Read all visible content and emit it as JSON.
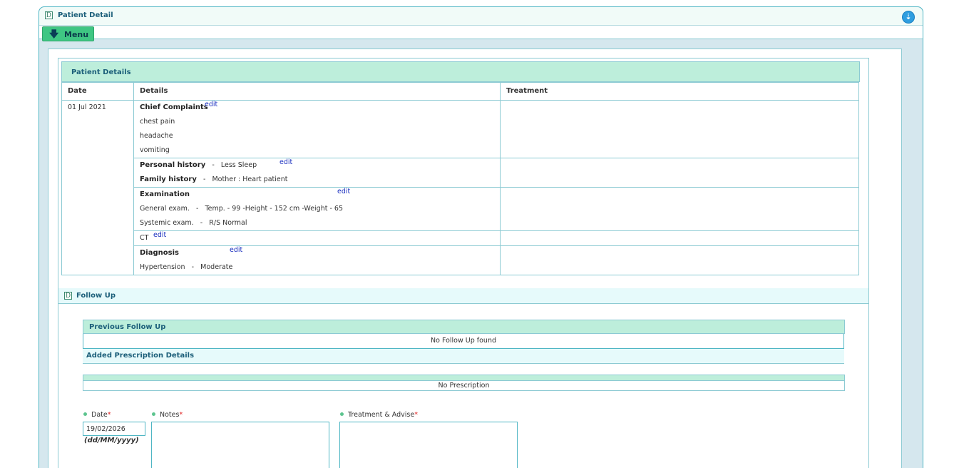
{
  "window": {
    "title": "Patient Detail",
    "icon": "d-icon",
    "action_icon": "download-circle-icon"
  },
  "menu": {
    "label": "Menu",
    "icon": "arrow-down-icon"
  },
  "patient_details": {
    "title": "Patient Details",
    "columns": [
      "Date",
      "Details",
      "Treatment"
    ],
    "date": "01 Jul 2021",
    "chief_complaints": {
      "label": "Chief Complaints",
      "edit": "edit",
      "items": [
        "chest pain",
        "headache",
        "vomiting"
      ]
    },
    "personal_history": {
      "label": "Personal history",
      "value": "Less Sleep",
      "edit": "edit"
    },
    "family_history": {
      "label": "Family history",
      "value": "Mother : Heart patient"
    },
    "examination": {
      "label": "Examination",
      "edit": "edit",
      "general_label": "General exam.",
      "general_value": "Temp. - 99 -Height - 152 cm -Weight - 65",
      "systemic_label": "Systemic exam.",
      "systemic_value": "R/S Normal"
    },
    "ct": {
      "label": "CT",
      "edit": "edit"
    },
    "diagnosis": {
      "label": "Diagnosis",
      "edit": "edit",
      "name": "Hypertension",
      "severity": "Moderate"
    },
    "separator": "-"
  },
  "follow_up": {
    "title": "Follow Up",
    "previous_title": "Previous Follow Up",
    "previous_empty": "No Follow Up found",
    "added_title": "Added Prescription Details",
    "prescription_empty": "No Prescription",
    "form": {
      "date_label": "Date",
      "notes_label": "Notes",
      "treatment_label": "Treatment & Advise",
      "required_mark": "*",
      "date_value": "19/02/2026",
      "date_format": "(dd/MM/yyyy)"
    }
  }
}
